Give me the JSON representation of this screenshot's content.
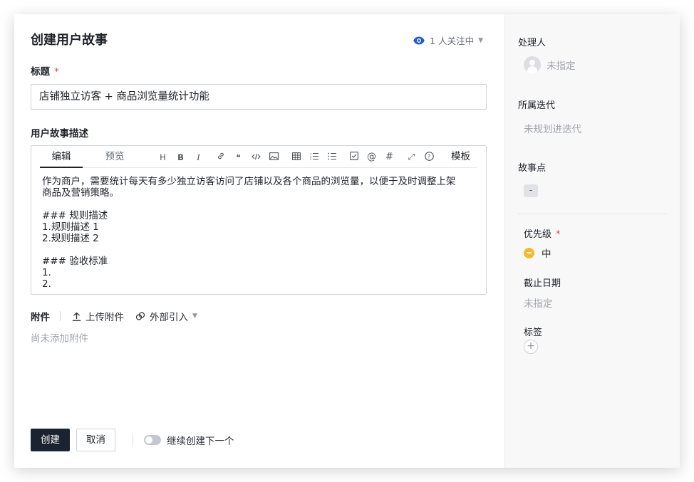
{
  "dialog": {
    "title": "创建用户故事",
    "watch": {
      "label": "1 人关注中",
      "accent": "#1e5bd6"
    }
  },
  "form": {
    "title_label": "标题",
    "required_mark": "*",
    "title_value": "店铺独立访客 + 商品浏览量统计功能",
    "desc_label": "用户故事描述",
    "editor": {
      "tabs": [
        "编辑",
        "预览"
      ],
      "active_tab": "编辑",
      "tools": [
        "H",
        "B",
        "I",
        "link-icon",
        "quote-icon",
        "code-icon",
        "image-icon",
        "table-icon",
        "ordered-list-icon",
        "bullet-list-icon",
        "checkbox-icon",
        "mention-icon",
        "hash-icon",
        "fullscreen-icon",
        "help-icon"
      ],
      "template_label": "模板",
      "lines": [
        "作为商户，需要统计每天有多少独立访客访问了店铺以及各个商品的浏览量，以便于及时调整上架",
        "商品及营销策略。",
        "",
        "### 规则描述",
        "1.规则描述 1",
        "2.规则描述 2",
        "",
        "### 验收标准",
        "1.",
        "2."
      ]
    },
    "attachments": {
      "label": "附件",
      "upload_label": "上传附件",
      "external_label": "外部引入",
      "empty_text": "尚未添加附件"
    }
  },
  "footer": {
    "create_label": "创建",
    "cancel_label": "取消",
    "continue_label": "继续创建下一个"
  },
  "side": {
    "assignee_label": "处理人",
    "assignee_value": "未指定",
    "iteration_label": "所属迭代",
    "iteration_value": "未规划进迭代",
    "points_label": "故事点",
    "points_value": "-",
    "priority_label": "优先级",
    "priority_value": "中",
    "priority_color": "#f5b82e",
    "due_label": "截止日期",
    "due_value": "未指定",
    "tags_label": "标签",
    "add_tag": "+"
  }
}
